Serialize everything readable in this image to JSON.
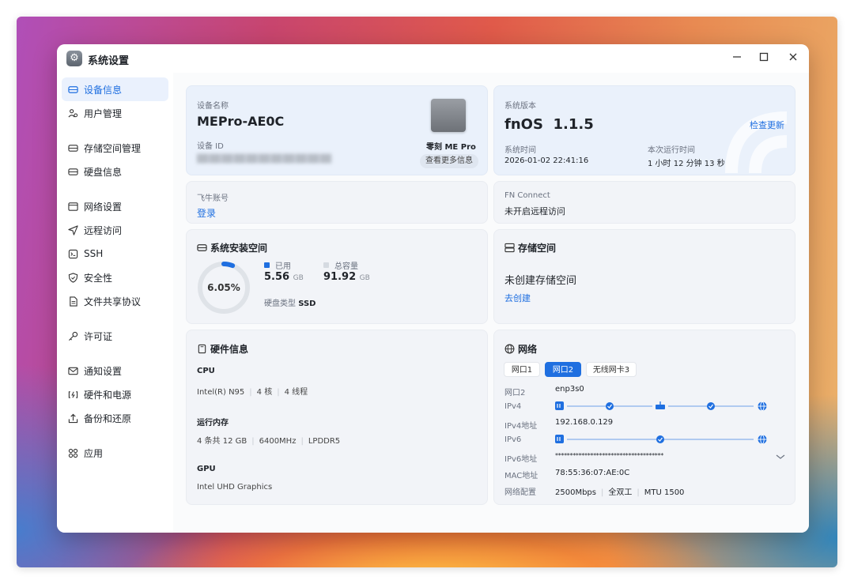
{
  "window": {
    "title": "系统设置"
  },
  "sidebar": {
    "items": [
      {
        "label": "设备信息",
        "icon": "hard-drive-icon"
      },
      {
        "label": "用户管理",
        "icon": "users-icon"
      },
      {
        "label": "存储空间管理",
        "icon": "storage-icon"
      },
      {
        "label": "硬盘信息",
        "icon": "disk-icon"
      },
      {
        "label": "网络设置",
        "icon": "network-icon"
      },
      {
        "label": "远程访问",
        "icon": "send-icon"
      },
      {
        "label": "SSH",
        "icon": "terminal-icon"
      },
      {
        "label": "安全性",
        "icon": "shield-icon"
      },
      {
        "label": "文件共享协议",
        "icon": "file-icon"
      },
      {
        "label": "许可证",
        "icon": "key-icon"
      },
      {
        "label": "通知设置",
        "icon": "mail-icon"
      },
      {
        "label": "硬件和电源",
        "icon": "power-icon"
      },
      {
        "label": "备份和还原",
        "icon": "backup-icon"
      },
      {
        "label": "应用",
        "icon": "apps-icon"
      }
    ]
  },
  "device": {
    "name_label": "设备名称",
    "name": "MEPro-AE0C",
    "id_label": "设备 ID",
    "id_blurred": "██ ██ ██ ██ ██ ██ ██ ██ ██ ██ ██",
    "model": "零刻 ME Pro",
    "more_info": "查看更多信息"
  },
  "system": {
    "version_label": "系统版本",
    "os_name": "fnOS",
    "os_version": "1.1.5",
    "check_update": "检查更新",
    "time_label": "系统时间",
    "time": "2026-01-02 22:41:16",
    "uptime_label": "本次运行时间",
    "uptime": "1 小时 12 分钟 13 秒"
  },
  "account": {
    "label": "飞牛账号",
    "login": "登录"
  },
  "fn_connect": {
    "label": "FN Connect",
    "status": "未开启远程访问"
  },
  "system_storage": {
    "title": "系统安装空间",
    "percent_text": "6.05%",
    "percent": 6.05,
    "used_label": "已用",
    "used_value": "5.56",
    "used_unit": "GB",
    "total_label": "总容量",
    "total_value": "91.92",
    "total_unit": "GB",
    "disk_type_label": "硬盘类型",
    "disk_type": "SSD",
    "used_color": "#1f6fe0",
    "total_color": "#d5dae1"
  },
  "storage_space": {
    "title": "存储空间",
    "status": "未创建存储空间",
    "create": "去创建"
  },
  "hardware": {
    "title": "硬件信息",
    "cpu_label": "CPU",
    "cpu": [
      "Intel(R) N95",
      "4 核",
      "4 线程"
    ],
    "ram_label": "运行内存",
    "ram": [
      "4 条共 12 GB",
      "6400MHz",
      "LPDDR5"
    ],
    "gpu_label": "GPU",
    "gpu": "Intel UHD Graphics"
  },
  "network": {
    "title": "网络",
    "tabs": [
      "网口1",
      "网口2",
      "无线网卡3"
    ],
    "active_tab": 1,
    "iface_label": "网口2",
    "iface": "enp3s0",
    "ipv4_label": "IPv4",
    "ipv4_addr_label": "IPv4地址",
    "ipv4_addr": "192.168.0.129",
    "ipv6_label": "IPv6",
    "ipv6_addr_label": "IPv6地址",
    "ipv6_addr": "*************************************",
    "mac_label": "MAC地址",
    "mac": "78:55:36:07:AE:0C",
    "config_label": "网络配置",
    "config": [
      "2500Mbps",
      "全双工",
      "MTU 1500"
    ]
  }
}
